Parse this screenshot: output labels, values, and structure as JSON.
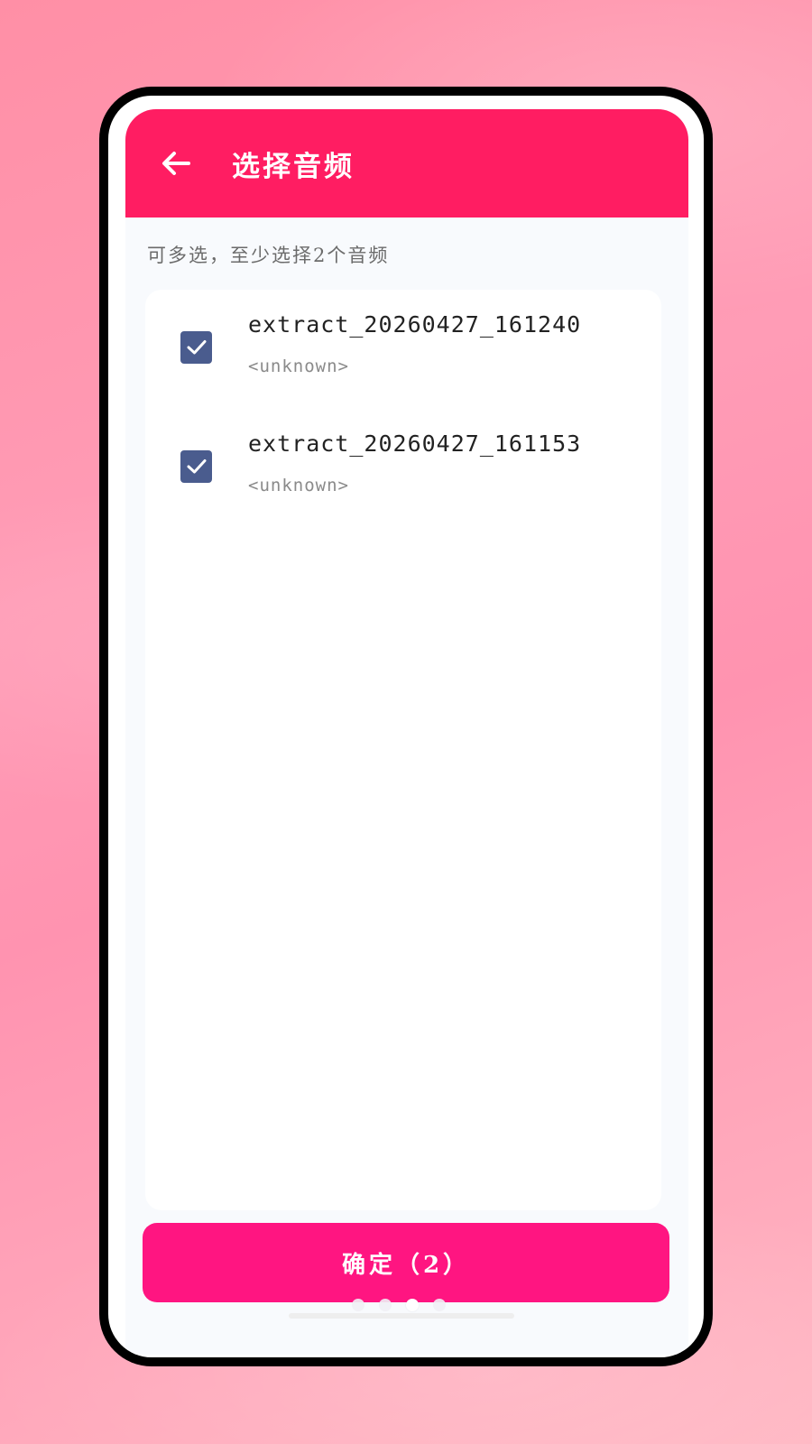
{
  "header": {
    "title": "选择音频",
    "back_icon": "arrow-left-icon"
  },
  "hint": "可多选，至少选择2个音频",
  "files": [
    {
      "name": "extract_20260427_161240",
      "artist": "<unknown>",
      "checked": true
    },
    {
      "name": "extract_20260427_161153",
      "artist": "<unknown>",
      "checked": true
    }
  ],
  "confirm_button": {
    "label": "确定（2）"
  },
  "page_indicator": {
    "total": 4,
    "active": 3
  },
  "colors": {
    "header": "#ff1d62",
    "button": "#ff1581",
    "checkbox": "#4a5c8e"
  }
}
